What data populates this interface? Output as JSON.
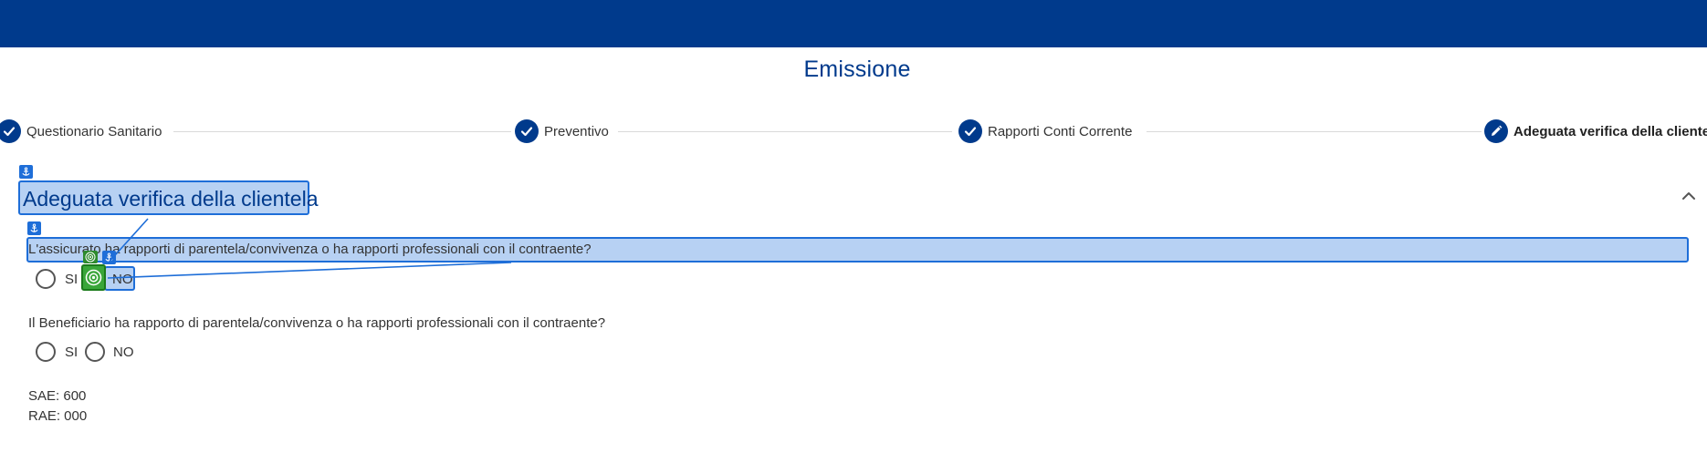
{
  "header": {
    "color": "#003a8c"
  },
  "page": {
    "title": "Emissione"
  },
  "stepper": {
    "steps": [
      {
        "label": "Questionario Sanitario",
        "icon": "check-icon",
        "state": "completed"
      },
      {
        "label": "Preventivo",
        "icon": "check-icon",
        "state": "completed"
      },
      {
        "label": "Rapporti Conti Corrente",
        "icon": "check-icon",
        "state": "completed"
      },
      {
        "label": "Adeguata verifica della cliente",
        "icon": "pencil-icon",
        "state": "active"
      }
    ]
  },
  "section": {
    "title": "Adeguata verifica della clientela",
    "toggle_icon": "chevron-up-icon",
    "questions": [
      {
        "text": "L'assicurato ha rapporti di parentela/convivenza o ha rapporti professionali con il contraente?",
        "options": [
          "SI",
          "NO"
        ]
      },
      {
        "text": "Il Beneficiario ha rapporto di parentela/convivenza o ha rapporti professionali con il contraente?",
        "options": [
          "SI",
          "NO"
        ]
      }
    ],
    "info": [
      {
        "text": "SAE: 600"
      },
      {
        "text": "RAE: 000"
      }
    ]
  },
  "overlay": {
    "highlight_color": "#1e6ed8",
    "target_color": "#3aa63a",
    "icons": [
      "anchor-icon",
      "target-icon"
    ]
  },
  "colors": {
    "primary": "#003a8c",
    "accent": "#1e6ed8",
    "highlight_fill": "#b7d1f3",
    "target": "#3aa63a"
  }
}
